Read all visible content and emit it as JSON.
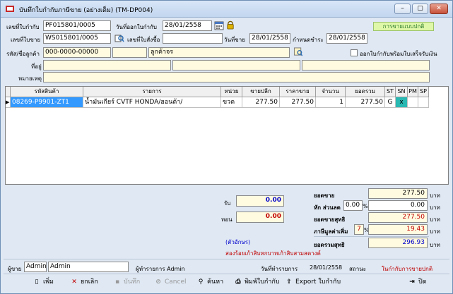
{
  "window": {
    "title": "บันทึกใบกำกับภาษีขาย (อย่างเต็ม) (TM-DP004)",
    "controls": [
      "–",
      "▢",
      "✕"
    ]
  },
  "header": {
    "invoice_no_label": "เลขที่ใบกำกับ",
    "invoice_no": "PF015801/0005",
    "invoice_date_label": "วันที่ออกใบกำกับ",
    "invoice_date": "28/01/2558",
    "status_badge": "การขายแบบปกติ",
    "sale_no_label": "เลขที่ใบขาย",
    "sale_no": "WS015801/0005",
    "order_no_label": "เลขที่ใบสั่งซื้อ",
    "order_no": "",
    "sale_date_label": "วันที่ขาย",
    "sale_date": "28/01/2558",
    "due_date_label": "กำหนดชำระ",
    "due_date": "28/01/2558",
    "customer_code_label": "รหัส/ชื่อลูกค้า",
    "customer_code": "000-0000-00000",
    "customer_name": "",
    "customer_type": "ลูกค้าจร",
    "cash_receipt_label": "ออกใบกำกับพร้อมใบเสร็จรับเงิน",
    "address_label": "ที่อยู่",
    "remark_label": "หมายเหตุ"
  },
  "grid": {
    "columns": [
      "รหัสสินค้า",
      "รายการ",
      "หน่วย",
      "ขายปลีก",
      "ราคาขาย",
      "จำนวน",
      "ยอดรวม",
      "ST",
      "SN",
      "PM",
      "SP"
    ],
    "rows": [
      {
        "marker": "▶",
        "code": "08269-P9901-ZT1",
        "desc": "น้ำมันเกียร์ CVTF HONDA/ฮอนด้า/",
        "unit": "ขวด",
        "retail": "277.50",
        "price": "277.50",
        "qty": "1",
        "total": "277.50",
        "st": "G",
        "sn": "x",
        "pm": "",
        "sp": ""
      }
    ]
  },
  "payment": {
    "receive_label": "รับ",
    "receive": "0.00",
    "change_label": "ทอน",
    "change": "0.00",
    "in_words_label": "(ตัวอักษร)",
    "in_words": "สองร้อยเก้าสิบหกบาทเก้าสิบสามสตางค์"
  },
  "totals": {
    "sales_label": "ยอดขาย",
    "sales": "277.50",
    "discount_label": "หัก ส่วนลด",
    "discount_pct": "0.00",
    "discount_pct_unit": "%",
    "discount": "0.00",
    "net_label": "ยอดขายสุทธิ",
    "net": "277.50",
    "vat_label": "ภาษีมูลค่าเพิ่ม",
    "vat_rate": "7",
    "vat_unit": "%",
    "vat": "19.43",
    "grand_label": "ยอดรวมสุทธิ",
    "grand": "296.93",
    "currency_1": "บาท",
    "currency_2": "บาท",
    "currency_3": "บาท",
    "currency_4": "บาท",
    "currency_5": "บาท"
  },
  "footer": {
    "seller_label": "ผู้ขาย",
    "seller_code": "Admin",
    "seller_name": "Admin",
    "operator": "ผู้ทำรายการ Admin",
    "txn_date_label": "วันที่ทำรายการ",
    "txn_date": "28/01/2558",
    "state_label": "สถานะ",
    "state": "ในกำกับการขายปกติ"
  },
  "toolbar": {
    "new": "เพิ่ม",
    "cancel_doc": "ยกเลิก",
    "save": "บันทึก",
    "cancel": "Cancel",
    "search": "ค้นหา",
    "print": "พิมพ์ใบกำกับ",
    "export": "Export ใบกำกับ",
    "close": "ปิด"
  },
  "colors": {
    "accent_red": "#c00000",
    "accent_blue": "#0000cc",
    "selection": "#3399ff",
    "badge": "#dff7a8"
  }
}
